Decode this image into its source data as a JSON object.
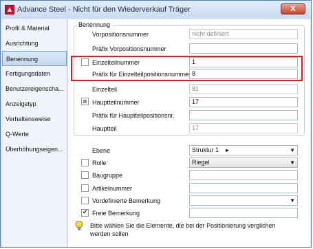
{
  "window": {
    "title": "Advance Steel - Nicht für den Wiederverkauf  Träger",
    "close_label": "X"
  },
  "sidebar": {
    "items": [
      {
        "label": "Profil & Material"
      },
      {
        "label": "Ausrichtung"
      },
      {
        "label": "Benennung"
      },
      {
        "label": "Fertigungsdaten"
      },
      {
        "label": "Benutzereigenscha..."
      },
      {
        "label": "Anzeigetyp"
      },
      {
        "label": "Verhaltensweise"
      },
      {
        "label": "Q-Werte"
      },
      {
        "label": "Überhöhungseigen..."
      }
    ],
    "selected": "Benennung"
  },
  "group": {
    "title": "Benennung",
    "rows": [
      {
        "label": "Vorpositionsnummer",
        "value": "nicht definiert",
        "enabled": false
      },
      {
        "label": "Präfix Vorpositionsnummer",
        "value": "",
        "enabled": true
      },
      {
        "label": "Einzelteilnummer",
        "value": "1",
        "enabled": true,
        "checked": false
      },
      {
        "label": "Präfix für Einzelteilpositionsnummer",
        "value": "8",
        "enabled": true
      },
      {
        "label": "Einzelteil",
        "value": "81",
        "enabled": false
      },
      {
        "label": "Hauptteilnummer",
        "value": "17",
        "enabled": true,
        "checked": "indeterminate"
      },
      {
        "label": "Präfix für Hauptteilpositionsnr.",
        "value": "",
        "enabled": true
      },
      {
        "label": "Hauptteil",
        "value": "17",
        "enabled": false
      }
    ]
  },
  "lower": {
    "ebene": {
      "label": "Ebene",
      "value": "Struktur 1"
    },
    "rolle": {
      "label": "Rolle",
      "value": "Riegel",
      "checked": false
    },
    "baugruppe": {
      "label": "Baugruppe",
      "value": "",
      "checked": false
    },
    "artikelnummer": {
      "label": "Artikelnummer",
      "value": "",
      "checked": false
    },
    "vordefinierte": {
      "label": "Vordefinierte Bemerkung",
      "value": "",
      "checked": false
    },
    "freie": {
      "label": "Freie Bemerkung",
      "value": "",
      "checked": true
    }
  },
  "info": {
    "text": "Bitte wählen Sie die Elemente, die bei der Positionierung verglichen werden sollen"
  },
  "colors": {
    "highlight": "#e01b1b",
    "selection": "#c3d9f2"
  }
}
